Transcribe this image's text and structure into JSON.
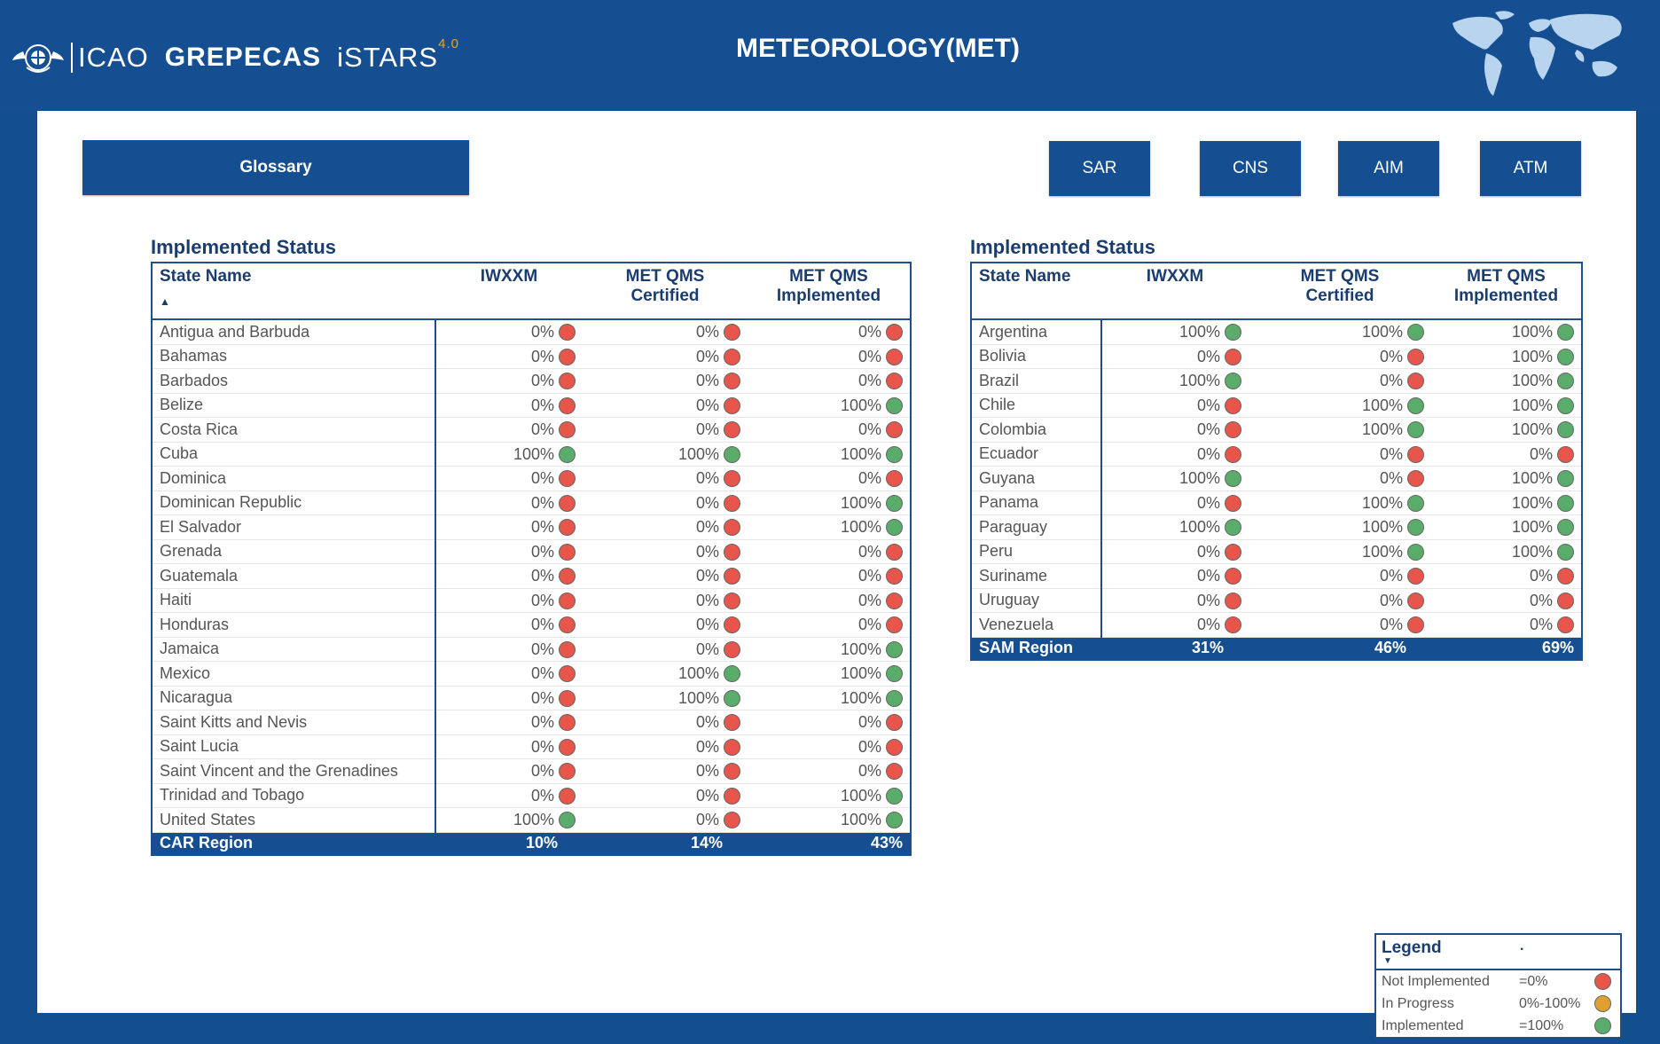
{
  "header": {
    "logo_icao": "ICAO",
    "logo_grepecas": "GREPECAS",
    "logo_istars": "iSTARS",
    "logo_version": "4.0",
    "title": "METEOROLOGY(MET)"
  },
  "nav": {
    "glossary": "Glossary",
    "sar": "SAR",
    "cns": "CNS",
    "aim": "AIM",
    "atm": "ATM"
  },
  "colors": {
    "not_implemented": "#e8554a",
    "in_progress": "#e0a030",
    "implemented": "#5aac6a",
    "brand": "#154f91"
  },
  "car_table": {
    "title": "Implemented Status",
    "headers": {
      "state": "State Name",
      "iwxxm": "IWXXM",
      "cert_1": "MET QMS",
      "cert_2": "Certified",
      "impl_1": "MET QMS",
      "impl_2": "Implemented"
    },
    "rows": [
      {
        "name": "Antigua and Barbuda",
        "iwxxm": "0%",
        "cert": "0%",
        "impl": "0%"
      },
      {
        "name": "Bahamas",
        "iwxxm": "0%",
        "cert": "0%",
        "impl": "0%"
      },
      {
        "name": "Barbados",
        "iwxxm": "0%",
        "cert": "0%",
        "impl": "0%"
      },
      {
        "name": "Belize",
        "iwxxm": "0%",
        "cert": "0%",
        "impl": "100%"
      },
      {
        "name": "Costa Rica",
        "iwxxm": "0%",
        "cert": "0%",
        "impl": "0%"
      },
      {
        "name": "Cuba",
        "iwxxm": "100%",
        "cert": "100%",
        "impl": "100%"
      },
      {
        "name": "Dominica",
        "iwxxm": "0%",
        "cert": "0%",
        "impl": "0%"
      },
      {
        "name": "Dominican Republic",
        "iwxxm": "0%",
        "cert": "0%",
        "impl": "100%"
      },
      {
        "name": "El Salvador",
        "iwxxm": "0%",
        "cert": "0%",
        "impl": "100%"
      },
      {
        "name": "Grenada",
        "iwxxm": "0%",
        "cert": "0%",
        "impl": "0%"
      },
      {
        "name": "Guatemala",
        "iwxxm": "0%",
        "cert": "0%",
        "impl": "0%"
      },
      {
        "name": "Haiti",
        "iwxxm": "0%",
        "cert": "0%",
        "impl": "0%"
      },
      {
        "name": "Honduras",
        "iwxxm": "0%",
        "cert": "0%",
        "impl": "0%"
      },
      {
        "name": "Jamaica",
        "iwxxm": "0%",
        "cert": "0%",
        "impl": "100%"
      },
      {
        "name": "Mexico",
        "iwxxm": "0%",
        "cert": "100%",
        "impl": "100%"
      },
      {
        "name": "Nicaragua",
        "iwxxm": "0%",
        "cert": "100%",
        "impl": "100%"
      },
      {
        "name": "Saint Kitts and Nevis",
        "iwxxm": "0%",
        "cert": "0%",
        "impl": "0%"
      },
      {
        "name": "Saint Lucia",
        "iwxxm": "0%",
        "cert": "0%",
        "impl": "0%"
      },
      {
        "name": "Saint Vincent and the Grenadines",
        "iwxxm": "0%",
        "cert": "0%",
        "impl": "0%"
      },
      {
        "name": "Trinidad and Tobago",
        "iwxxm": "0%",
        "cert": "0%",
        "impl": "100%"
      },
      {
        "name": "United States",
        "iwxxm": "100%",
        "cert": "0%",
        "impl": "100%"
      }
    ],
    "total": {
      "name": "CAR Region",
      "iwxxm": "10%",
      "cert": "14%",
      "impl": "43%"
    }
  },
  "sam_table": {
    "title": "Implemented Status",
    "headers": {
      "state": "State Name",
      "iwxxm": "IWXXM",
      "cert_1": "MET QMS",
      "cert_2": "Certified",
      "impl_1": "MET QMS",
      "impl_2": "Implemented"
    },
    "rows": [
      {
        "name": "Argentina",
        "iwxxm": "100%",
        "cert": "100%",
        "impl": "100%"
      },
      {
        "name": "Bolivia",
        "iwxxm": "0%",
        "cert": "0%",
        "impl": "100%"
      },
      {
        "name": "Brazil",
        "iwxxm": "100%",
        "cert": "0%",
        "impl": "100%"
      },
      {
        "name": "Chile",
        "iwxxm": "0%",
        "cert": "100%",
        "impl": "100%"
      },
      {
        "name": "Colombia",
        "iwxxm": "0%",
        "cert": "100%",
        "impl": "100%"
      },
      {
        "name": "Ecuador",
        "iwxxm": "0%",
        "cert": "0%",
        "impl": "0%"
      },
      {
        "name": "Guyana",
        "iwxxm": "100%",
        "cert": "0%",
        "impl": "100%"
      },
      {
        "name": "Panama",
        "iwxxm": "0%",
        "cert": "100%",
        "impl": "100%"
      },
      {
        "name": "Paraguay",
        "iwxxm": "100%",
        "cert": "100%",
        "impl": "100%"
      },
      {
        "name": "Peru",
        "iwxxm": "0%",
        "cert": "100%",
        "impl": "100%"
      },
      {
        "name": "Suriname",
        "iwxxm": "0%",
        "cert": "0%",
        "impl": "0%"
      },
      {
        "name": "Uruguay",
        "iwxxm": "0%",
        "cert": "0%",
        "impl": "0%"
      },
      {
        "name": "Venezuela",
        "iwxxm": "0%",
        "cert": "0%",
        "impl": "0%"
      }
    ],
    "total": {
      "name": "SAM Region",
      "iwxxm": "31%",
      "cert": "46%",
      "impl": "69%"
    }
  },
  "legend": {
    "title": "Legend",
    "mark": ".",
    "items": [
      {
        "label": "Not Implemented",
        "range": "=0%",
        "status": "not_implemented"
      },
      {
        "label": "In Progress",
        "range": "0%-100%",
        "status": "in_progress"
      },
      {
        "label": "Implemented",
        "range": "=100%",
        "status": "implemented"
      }
    ]
  }
}
